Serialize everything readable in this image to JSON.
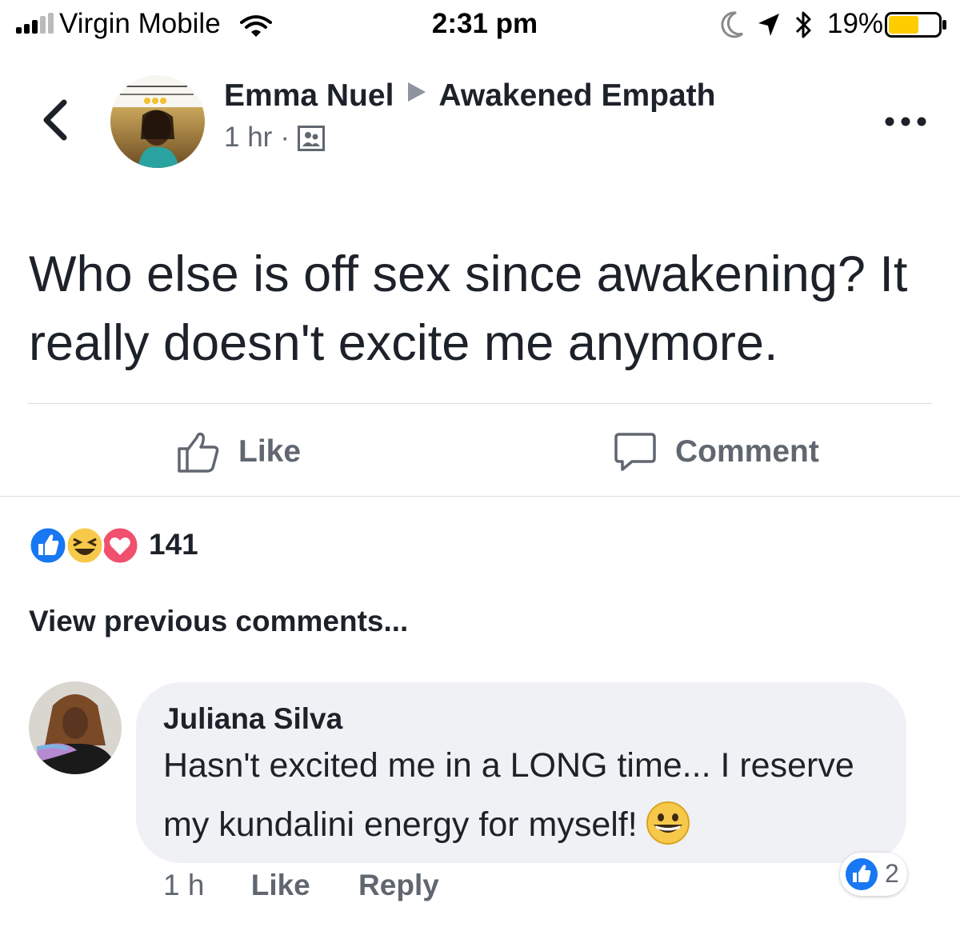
{
  "status_bar": {
    "carrier": "Virgin Mobile",
    "time": "2:31 pm",
    "battery_percent": "19%",
    "signal_bars_filled": 3,
    "signal_bars_total": 5,
    "battery_level": 0.19
  },
  "header": {
    "author": "Emma Nuel",
    "group": "Awakened Empath",
    "time_ago": "1 hr",
    "separator": "·",
    "audience_icon": "group-icon"
  },
  "post": {
    "text": "Who else is off sex since awakening? It really doesn't excite me anymore."
  },
  "actions": {
    "like_label": "Like",
    "comment_label": "Comment"
  },
  "reactions": {
    "types": [
      "like-reaction-icon",
      "haha-reaction-icon",
      "love-reaction-icon"
    ],
    "count": "141"
  },
  "comments": {
    "view_previous": "View previous comments...",
    "items": [
      {
        "author": "Juliana Silva",
        "text": "Hasn't excited me in a LONG time... I reserve my kundalini energy for myself!",
        "emoji": "grinning-face-emoji",
        "time": "1 h",
        "like_label": "Like",
        "reply_label": "Reply",
        "like_count": "2"
      }
    ]
  },
  "colors": {
    "facebook_blue": "#1877f2",
    "text_primary": "#1d2129",
    "text_secondary": "#616770",
    "bubble_bg": "#f0f1f4",
    "love_red": "#f0506e",
    "haha_yellow": "#f7c94a",
    "battery_yellow": "#ffcc00"
  }
}
